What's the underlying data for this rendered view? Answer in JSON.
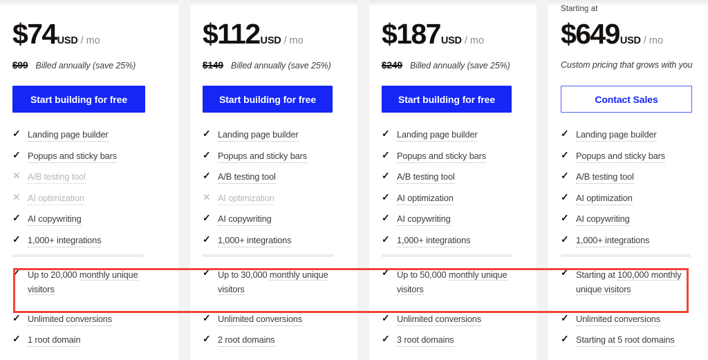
{
  "theme": {
    "accent_blue": "#1526F5",
    "outline_blue": "#4F5EF7",
    "highlight_red": "#F0433A",
    "text_dark": "#14100E",
    "text_body": "#3E3C3A",
    "text_muted": "#B9B7B4",
    "page_bg": "#F4F3F1"
  },
  "icons": {
    "check": "✓",
    "cross": "✕"
  },
  "plans": [
    {
      "id": "plan-1",
      "starting_at_label": "",
      "price_amount": "$74",
      "price_currency": "USD",
      "price_period": "/ mo",
      "old_price": "$99",
      "billing_note": "Billed annually (save 25%)",
      "cta_label": "Start building for free",
      "cta_style": "primary",
      "features": [
        {
          "label": "Landing page builder",
          "included": true
        },
        {
          "label": "Popups and sticky bars",
          "included": true
        },
        {
          "label": "A/B testing tool",
          "included": false
        },
        {
          "label": "AI optimization",
          "included": false
        },
        {
          "label": "AI copywriting",
          "included": true
        },
        {
          "label": "1,000+ integrations",
          "included": true
        }
      ],
      "highlight_feature": {
        "line1_plain": "Up to 20,000 ",
        "line1_underlined": "monthly unique",
        "line2_underlined": "visitors",
        "included": true
      },
      "bottom_features": [
        {
          "label": "Unlimited conversions",
          "included": true
        },
        {
          "label": "1 root domain",
          "included": true
        }
      ]
    },
    {
      "id": "plan-2",
      "starting_at_label": "",
      "price_amount": "$112",
      "price_currency": "USD",
      "price_period": "/ mo",
      "old_price": "$149",
      "billing_note": "Billed annually (save 25%)",
      "cta_label": "Start building for free",
      "cta_style": "primary",
      "features": [
        {
          "label": "Landing page builder",
          "included": true
        },
        {
          "label": "Popups and sticky bars",
          "included": true
        },
        {
          "label": "A/B testing tool",
          "included": true
        },
        {
          "label": "AI optimization",
          "included": false
        },
        {
          "label": "AI copywriting",
          "included": true
        },
        {
          "label": "1,000+ integrations",
          "included": true
        }
      ],
      "highlight_feature": {
        "line1_plain": "Up to 30,000 ",
        "line1_underlined": "monthly unique",
        "line2_underlined": "visitors",
        "included": true
      },
      "bottom_features": [
        {
          "label": "Unlimited conversions",
          "included": true
        },
        {
          "label": "2 root domains",
          "included": true
        }
      ]
    },
    {
      "id": "plan-3",
      "starting_at_label": "",
      "price_amount": "$187",
      "price_currency": "USD",
      "price_period": "/ mo",
      "old_price": "$249",
      "billing_note": "Billed annually (save 25%)",
      "cta_label": "Start building for free",
      "cta_style": "primary",
      "features": [
        {
          "label": "Landing page builder",
          "included": true
        },
        {
          "label": "Popups and sticky bars",
          "included": true
        },
        {
          "label": "A/B testing tool",
          "included": true
        },
        {
          "label": "AI optimization",
          "included": true
        },
        {
          "label": "AI copywriting",
          "included": true
        },
        {
          "label": "1,000+ integrations",
          "included": true
        }
      ],
      "highlight_feature": {
        "line1_plain": "Up to 50,000 ",
        "line1_underlined": "monthly unique",
        "line2_underlined": "visitors",
        "included": true
      },
      "bottom_features": [
        {
          "label": "Unlimited conversions",
          "included": true
        },
        {
          "label": "3 root domains",
          "included": true
        }
      ]
    },
    {
      "id": "plan-4",
      "starting_at_label": "Starting at",
      "price_amount": "$649",
      "price_currency": "USD",
      "price_period": "/ mo",
      "old_price": "",
      "billing_note": "Custom pricing that grows with you",
      "cta_label": "Contact Sales",
      "cta_style": "outline",
      "features": [
        {
          "label": "Landing page builder",
          "included": true
        },
        {
          "label": "Popups and sticky bars",
          "included": true
        },
        {
          "label": "A/B testing tool",
          "included": true
        },
        {
          "label": "AI optimization",
          "included": true
        },
        {
          "label": "AI copywriting",
          "included": true
        },
        {
          "label": "1,000+ integrations",
          "included": true
        }
      ],
      "highlight_feature": {
        "line1_plain": "Starting at ",
        "line1_underlined": "100,000 monthly",
        "line2_underlined": "unique visitors",
        "included": true
      },
      "bottom_features": [
        {
          "label": "Unlimited conversions",
          "included": true
        },
        {
          "label": "Starting at 5 root domains",
          "included": true
        }
      ]
    }
  ]
}
